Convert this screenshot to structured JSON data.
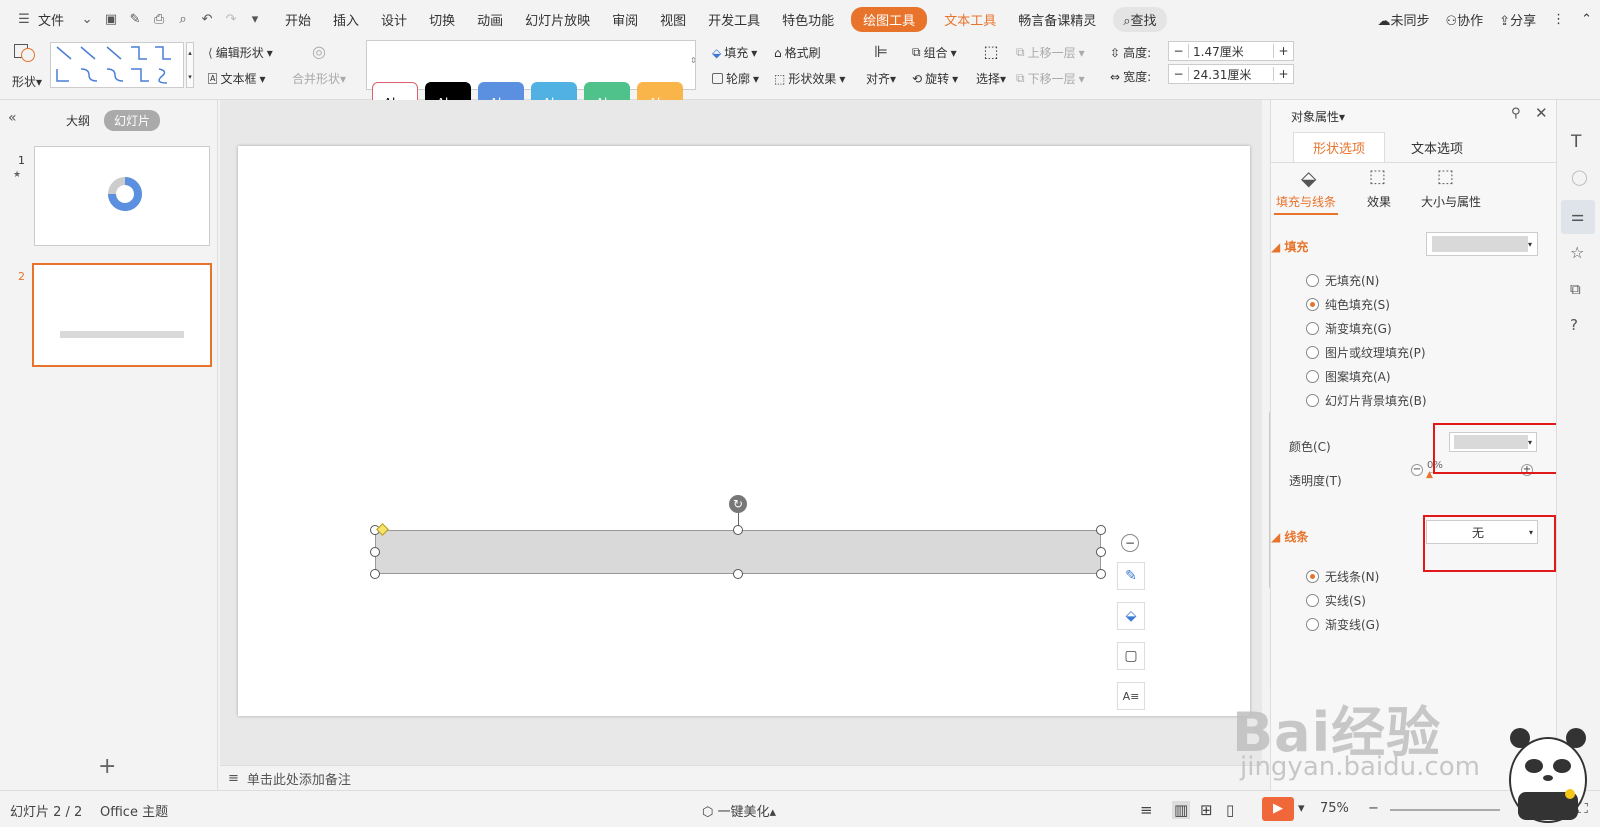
{
  "menu": {
    "file_label": "文件",
    "tabs": [
      "开始",
      "插入",
      "设计",
      "切换",
      "动画",
      "幻灯片放映",
      "审阅",
      "视图",
      "开发工具",
      "特色功能"
    ],
    "drawing_tools": "绘图工具",
    "text_tools": "文本工具",
    "extra": "畅言备课精灵",
    "search": "查找",
    "sync": "未同步",
    "collab": "协作",
    "share": "分享"
  },
  "ribbon": {
    "shape": "形状",
    "edit_shape": "编辑形状",
    "textbox": "文本框",
    "merge_shape": "合并形状",
    "styles": [
      "Abc",
      "Abc",
      "Abc",
      "Abc",
      "Abc",
      "Abc"
    ],
    "style_colors": [
      "#ffffff",
      "#000000",
      "#5b8fdf",
      "#52b1e3",
      "#4fc18a",
      "#f9b54a"
    ],
    "fill": "填充",
    "format_painter": "格式刷",
    "outline": "轮廓",
    "shape_effect": "形状效果",
    "align": "对齐",
    "group": "组合",
    "rotate": "旋转",
    "select": "选择",
    "bring_forward": "上移一层",
    "send_backward": "下移一层",
    "height_label": "高度:",
    "height_value": "1.47厘米",
    "width_label": "宽度:",
    "width_value": "24.31厘米"
  },
  "left_panel": {
    "outline_tab": "大纲",
    "slides_tab": "幻灯片",
    "slide_numbers": [
      "1",
      "2"
    ]
  },
  "notes": {
    "placeholder": "单击此处添加备注"
  },
  "props": {
    "title": "对象属性",
    "tab_shape": "形状选项",
    "tab_text": "文本选项",
    "sub_fill_line": "填充与线条",
    "sub_effect": "效果",
    "sub_size": "大小与属性",
    "fill_section": "填充",
    "fill_options": [
      "无填充(N)",
      "纯色填充(S)",
      "渐变填充(G)",
      "图片或纹理填充(P)",
      "图案填充(A)",
      "幻灯片背景填充(B)"
    ],
    "color_label": "颜色(C)",
    "transparency_label": "透明度(T)",
    "transparency_value": "0%",
    "line_section": "线条",
    "line_combo_value": "无",
    "line_options": [
      "无线条(N)",
      "实线(S)",
      "渐变线(G)"
    ],
    "fill_color": "#d9d9d9"
  },
  "status": {
    "slide_counter": "幻灯片 2 / 2",
    "theme": "Office 主题",
    "beautify": "一键美化",
    "zoom": "75%"
  },
  "watermark": {
    "brand": "Bai经验",
    "url": "jingyan.baidu.com"
  }
}
